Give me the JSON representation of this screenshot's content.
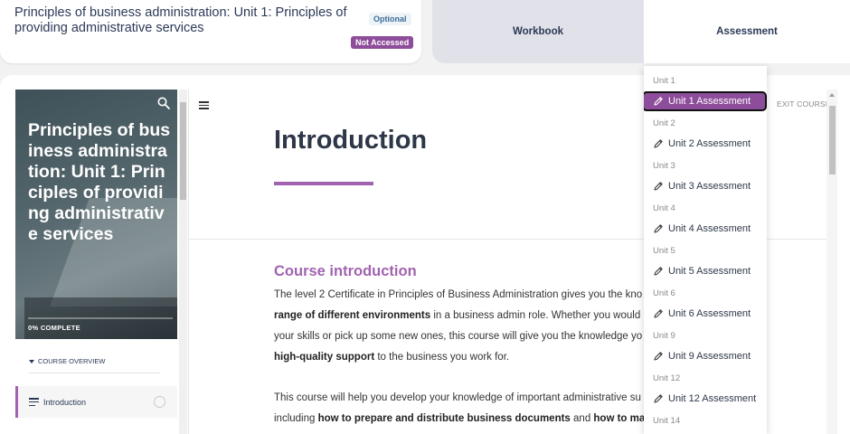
{
  "header": {
    "course_title": "Principles of business administration: Unit 1: Principles of providing administrative services",
    "optional_badge": "Optional",
    "status_badge": "Not Accessed",
    "tabs": [
      {
        "label": "Workbook"
      },
      {
        "label": "Assessment"
      }
    ]
  },
  "sidebar": {
    "cover_title": "Principles of business administration: Unit 1: Principles of providing administrative services",
    "progress_label": "0% COMPLETE",
    "progress_fraction": 0,
    "course_overview_label": "COURSE OVERVIEW",
    "items": [
      {
        "label": "Introduction"
      }
    ]
  },
  "toolbar": {
    "exit_label": "EXIT COURSE"
  },
  "content": {
    "heading": "Introduction",
    "subheading": "Course introduction",
    "paragraph1": [
      [
        {
          "t": "The level 2 Certificate in Principles of Business Administration gives you the kno",
          "b": false
        }
      ],
      [
        {
          "t": "range of different environments",
          "b": true
        },
        {
          "t": " in a business admin role. Whether you would li",
          "b": false
        }
      ],
      [
        {
          "t": "your skills or pick up some new ones, this course will give you the knowledge yo",
          "b": false
        }
      ],
      [
        {
          "t": "high-quality support",
          "b": true
        },
        {
          "t": " to the business you work for.",
          "b": false
        }
      ]
    ],
    "paragraph2": [
      [
        {
          "t": "This course will help you develop your knowledge of important administrative su",
          "b": false
        }
      ],
      [
        {
          "t": "including ",
          "b": false
        },
        {
          "t": "how to prepare and distribute business documents",
          "b": true
        },
        {
          "t": " and ",
          "b": false
        },
        {
          "t": "how to manag",
          "b": true
        }
      ]
    ]
  },
  "dropdown": {
    "groups": [
      {
        "unit": "Unit 1",
        "item": "Unit 1 Assessment",
        "selected": true
      },
      {
        "unit": "Unit 2",
        "item": "Unit 2 Assessment",
        "selected": false
      },
      {
        "unit": "Unit 3",
        "item": "Unit 3 Assessment",
        "selected": false
      },
      {
        "unit": "Unit 4",
        "item": "Unit 4 Assessment",
        "selected": false
      },
      {
        "unit": "Unit 5",
        "item": "Unit 5 Assessment",
        "selected": false
      },
      {
        "unit": "Unit 6",
        "item": "Unit 6 Assessment",
        "selected": false
      },
      {
        "unit": "Unit 9",
        "item": "Unit 9 Assessment",
        "selected": false
      },
      {
        "unit": "Unit 12",
        "item": "Unit 12 Assessment",
        "selected": false
      },
      {
        "unit": "Unit 14",
        "item": null,
        "selected": false
      }
    ]
  },
  "colors": {
    "accent": "#a163b0",
    "badge_status_bg": "#8e4d9a",
    "text_primary": "#2b3a57"
  }
}
